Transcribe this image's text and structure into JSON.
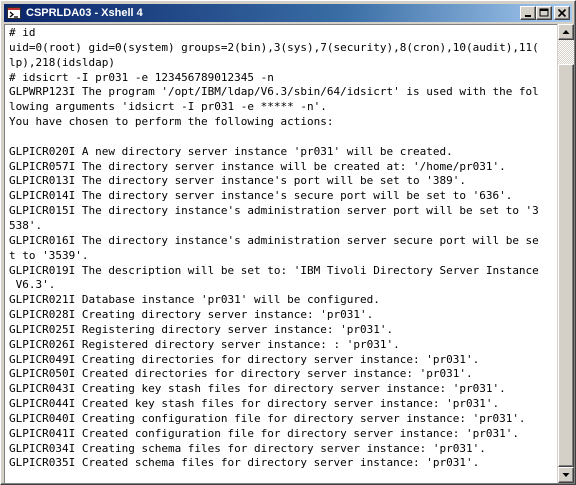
{
  "window": {
    "title": "CSPRLDA03 - Xshell 4"
  },
  "terminal": {
    "lines": [
      "# id",
      "uid=0(root) gid=0(system) groups=2(bin),3(sys),7(security),8(cron),10(audit),11(",
      "lp),218(idsldap)",
      "# idsicrt -I pr031 -e 123456789012345 -n",
      "GLPWRP123I The program '/opt/IBM/ldap/V6.3/sbin/64/idsicrt' is used with the fol",
      "lowing arguments 'idsicrt -I pr031 -e ***** -n'.",
      "You have chosen to perform the following actions:",
      "",
      "GLPICR020I A new directory server instance 'pr031' will be created.",
      "GLPICR057I The directory server instance will be created at: '/home/pr031'.",
      "GLPICR013I The directory server instance's port will be set to '389'.",
      "GLPICR014I The directory server instance's secure port will be set to '636'.",
      "GLPICR015I The directory instance's administration server port will be set to '3",
      "538'.",
      "GLPICR016I The directory instance's administration server secure port will be se",
      "t to '3539'.",
      "GLPICR019I The description will be set to: 'IBM Tivoli Directory Server Instance",
      " V6.3'.",
      "GLPICR021I Database instance 'pr031' will be configured.",
      "GLPICR028I Creating directory server instance: 'pr031'.",
      "GLPICR025I Registering directory server instance: 'pr031'.",
      "GLPICR026I Registered directory server instance: : 'pr031'.",
      "GLPICR049I Creating directories for directory server instance: 'pr031'.",
      "GLPICR050I Created directories for directory server instance: 'pr031'.",
      "GLPICR043I Creating key stash files for directory server instance: 'pr031'.",
      "GLPICR044I Created key stash files for directory server instance: 'pr031'.",
      "GLPICR040I Creating configuration file for directory server instance: 'pr031'.",
      "GLPICR041I Created configuration file for directory server instance: 'pr031'.",
      "GLPICR034I Creating schema files for directory server instance: 'pr031'.",
      "GLPICR035I Created schema files for directory server instance: 'pr031'."
    ]
  },
  "icons": {
    "app": "xshell-app-icon",
    "minimize": "minimize-icon",
    "maximize": "maximize-icon",
    "close": "close-icon",
    "scroll_up": "scroll-up-arrow-icon",
    "scroll_down": "scroll-down-arrow-icon"
  },
  "colors": {
    "titlebar_start": "#0a246a",
    "titlebar_end": "#a6caf0",
    "terminal_bg": "#ffffff",
    "terminal_fg": "#000000"
  }
}
